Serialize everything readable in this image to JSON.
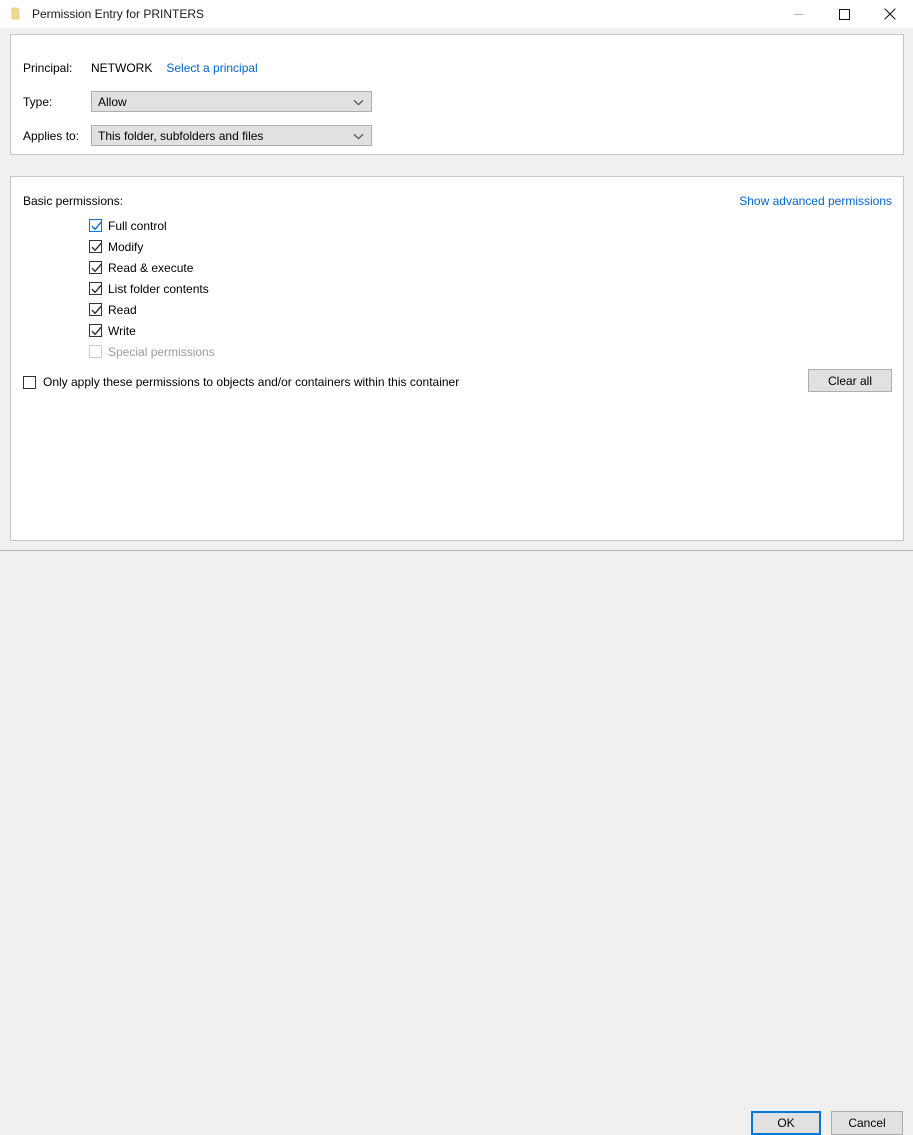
{
  "window": {
    "title": "Permission Entry for PRINTERS",
    "icon": "folder-icon",
    "controls": {
      "minimize": "minimize-icon",
      "maximize": "maximize-icon",
      "close": "close-icon"
    }
  },
  "principal_panel": {
    "principal_label": "Principal:",
    "principal_value": "NETWORK",
    "select_principal_link": "Select a principal",
    "type_label": "Type:",
    "type_value": "Allow",
    "applies_to_label": "Applies to:",
    "applies_to_value": "This folder, subfolders and files"
  },
  "permissions_panel": {
    "section_label": "Basic permissions:",
    "advanced_link": "Show advanced permissions",
    "permissions": [
      {
        "label": "Full control",
        "checked": true,
        "disabled": false,
        "focused": true
      },
      {
        "label": "Modify",
        "checked": true,
        "disabled": false,
        "focused": false
      },
      {
        "label": "Read & execute",
        "checked": true,
        "disabled": false,
        "focused": false
      },
      {
        "label": "List folder contents",
        "checked": true,
        "disabled": false,
        "focused": false
      },
      {
        "label": "Read",
        "checked": true,
        "disabled": false,
        "focused": false
      },
      {
        "label": "Write",
        "checked": true,
        "disabled": false,
        "focused": false
      },
      {
        "label": "Special permissions",
        "checked": false,
        "disabled": true,
        "focused": false
      }
    ],
    "only_apply_label": "Only apply these permissions to objects and/or containers within this container",
    "only_apply_checked": false,
    "clear_all_label": "Clear all"
  },
  "footer": {
    "ok_label": "OK",
    "cancel_label": "Cancel"
  },
  "colors": {
    "accent": "#0078d7",
    "link": "#0066cc",
    "dialog_bg": "#f0f0f0",
    "panel_bg": "#ffffff",
    "panel_border": "#c6c6c6",
    "control_bg": "#e1e1e1",
    "control_border": "#adadad",
    "disabled_text": "#9b9b9b",
    "folder_icon": "#f3d98b"
  }
}
